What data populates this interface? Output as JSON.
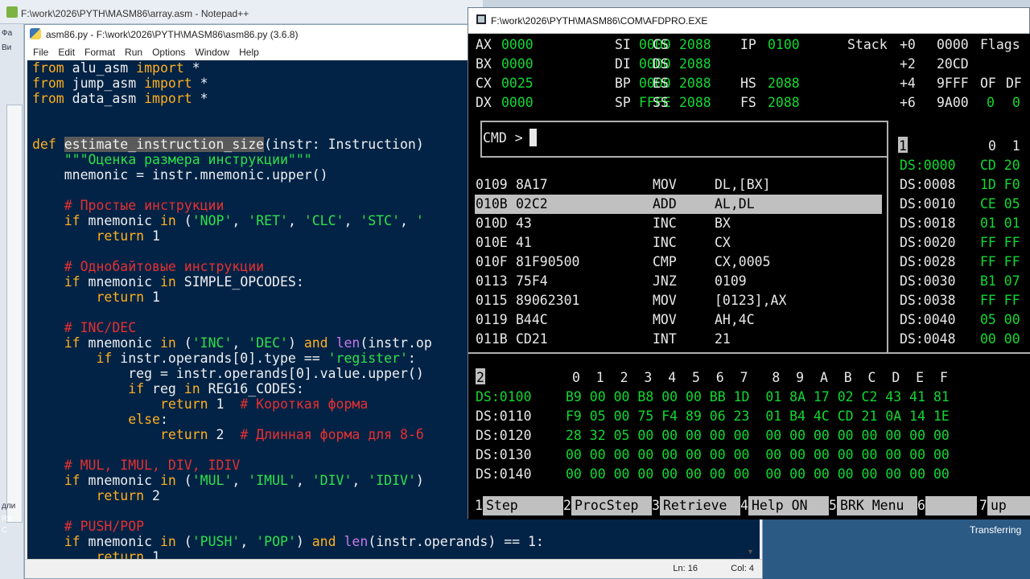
{
  "notepad": {
    "title": "F:\\work\\2026\\PYTH\\MASM86\\array.asm - Notepad++"
  },
  "left_strip": {
    "labels": [
      "Фа",
      "Ви"
    ],
    "bottom_label": "дли",
    "bottom2": "Re",
    "bottom3": "C"
  },
  "idle": {
    "title": "asm86.py - F:\\work\\2026\\PYTH\\MASM86\\asm86.py (3.6.8)",
    "menu": [
      "File",
      "Edit",
      "Format",
      "Run",
      "Options",
      "Window",
      "Help"
    ],
    "status_ln": "Ln: 16",
    "status_col": "Col: 4"
  },
  "afd": {
    "title": "F:\\work\\2026\\PYTH\\MASM86\\COM\\AFDPRO.EXE",
    "registers": [
      [
        {
          "n": "AX",
          "v": "0000"
        },
        {
          "n": "SI",
          "v": "0000"
        },
        {
          "n": "CS",
          "v": "2088"
        },
        {
          "n": "IP",
          "v": "0100"
        }
      ],
      [
        {
          "n": "BX",
          "v": "0000"
        },
        {
          "n": "DI",
          "v": "0000"
        },
        {
          "n": "DS",
          "v": "2088"
        }
      ],
      [
        {
          "n": "CX",
          "v": "0025"
        },
        {
          "n": "BP",
          "v": "0000"
        },
        {
          "n": "ES",
          "v": "2088"
        },
        {
          "n": "HS",
          "v": "2088"
        }
      ],
      [
        {
          "n": "DX",
          "v": "0000"
        },
        {
          "n": "SP",
          "v": "FFFE"
        },
        {
          "n": "SS",
          "v": "2088"
        },
        {
          "n": "FS",
          "v": "2088"
        }
      ]
    ],
    "stack_label": "Stack",
    "stack": [
      {
        "off": "+0",
        "val": "0000"
      },
      {
        "off": "+2",
        "val": "20CD"
      },
      {
        "off": "+4",
        "val": "9FFF"
      },
      {
        "off": "+6",
        "val": "9A00"
      }
    ],
    "flags_label": "Flags",
    "flag_names": [
      "OF",
      "DF"
    ],
    "flag_vals": [
      "0",
      "0"
    ],
    "cmd_prompt": "CMD >",
    "disasm": [
      {
        "addr": "0109",
        "bytes": "8A17",
        "op": "MOV",
        "args": "DL,[BX]"
      },
      {
        "addr": "010B",
        "bytes": "02C2",
        "op": "ADD",
        "args": "AL,DL"
      },
      {
        "addr": "010D",
        "bytes": "43",
        "op": "INC",
        "args": "BX"
      },
      {
        "addr": "010E",
        "bytes": "41",
        "op": "INC",
        "args": "CX"
      },
      {
        "addr": "010F",
        "bytes": "81F90500",
        "op": "CMP",
        "args": "CX,0005"
      },
      {
        "addr": "0113",
        "bytes": "75F4",
        "op": "JNZ",
        "args": "0109"
      },
      {
        "addr": "0115",
        "bytes": "89062301",
        "op": "MOV",
        "args": "[0123],AX"
      },
      {
        "addr": "0119",
        "bytes": "B44C",
        "op": "MOV",
        "args": "AH,4C"
      },
      {
        "addr": "011B",
        "bytes": "CD21",
        "op": "INT",
        "args": "21"
      }
    ],
    "panel1_id": "1",
    "panel1_header": "0  1",
    "panel1_rows": [
      {
        "addr": "DS:0000",
        "b": "CD 20"
      },
      {
        "addr": "DS:0008",
        "b": "1D F0"
      },
      {
        "addr": "DS:0010",
        "b": "CE 05"
      },
      {
        "addr": "DS:0018",
        "b": "01 01"
      },
      {
        "addr": "DS:0020",
        "b": "FF FF"
      },
      {
        "addr": "DS:0028",
        "b": "FF FF"
      },
      {
        "addr": "DS:0030",
        "b": "B1 07"
      },
      {
        "addr": "DS:0038",
        "b": "FF FF"
      },
      {
        "addr": "DS:0040",
        "b": "05 00"
      },
      {
        "addr": "DS:0048",
        "b": "00 00"
      }
    ],
    "panel2_id": "2",
    "panel2_header": "0  1  2  3  4  5  6  7   8  9  A  B  C  D  E  F",
    "panel2_rows": [
      {
        "addr": "DS:0100",
        "b": "B9 00 00 B8 00 00 BB 1D  01 8A 17 02 C2 43 41 81"
      },
      {
        "addr": "DS:0110",
        "b": "F9 05 00 75 F4 89 06 23  01 B4 4C CD 21 0A 14 1E"
      },
      {
        "addr": "DS:0120",
        "b": "28 32 05 00 00 00 00 00  00 00 00 00 00 00 00 00"
      },
      {
        "addr": "DS:0130",
        "b": "00 00 00 00 00 00 00 00  00 00 00 00 00 00 00 00"
      },
      {
        "addr": "DS:0140",
        "b": "00 00 00 00 00 00 00 00  00 00 00 00 00 00 00 00"
      }
    ],
    "fkeys": [
      {
        "num": "1",
        "label": " Step"
      },
      {
        "num": "2",
        "label": "ProcStep"
      },
      {
        "num": "3",
        "label": "Retrieve"
      },
      {
        "num": "4",
        "label": "Help ON"
      },
      {
        "num": "5",
        "label": "BRK Menu"
      },
      {
        "num": "6",
        "label": ""
      },
      {
        "num": "7",
        "label": " up"
      }
    ]
  },
  "taskbar": {
    "status": "Transferring"
  },
  "code_lines": [
    "from alu_asm import *",
    "from jump_asm import *",
    "from data_asm import *",
    "",
    "",
    "def estimate_instruction_size(instr: Instruction)",
    "    \"\"\"Оценка размера инструкции\"\"\"",
    "    mnemonic = instr.mnemonic.upper()",
    "",
    "    # Простые инструкции",
    "    if mnemonic in ('NOP', 'RET', 'CLC', 'STC', '",
    "        return 1",
    "",
    "    # Однобайтовые инструкции",
    "    if mnemonic in SIMPLE_OPCODES:",
    "        return 1",
    "",
    "    # INC/DEC",
    "    if mnemonic in ('INC', 'DEC') and len(instr.op",
    "        if instr.operands[0].type == 'register':",
    "            reg = instr.operands[0].value.upper()",
    "            if reg in REG16_CODES:",
    "                return 1  # Короткая форма",
    "            else:",
    "                return 2  # Длинная форма для 8-б",
    "",
    "    # MUL, IMUL, DIV, IDIV",
    "    if mnemonic in ('MUL', 'IMUL', 'DIV', 'IDIV')",
    "        return 2",
    "",
    "    # PUSH/POP",
    "    if mnemonic in ('PUSH', 'POP') and len(instr.operands) == 1:",
    "        return 1"
  ]
}
